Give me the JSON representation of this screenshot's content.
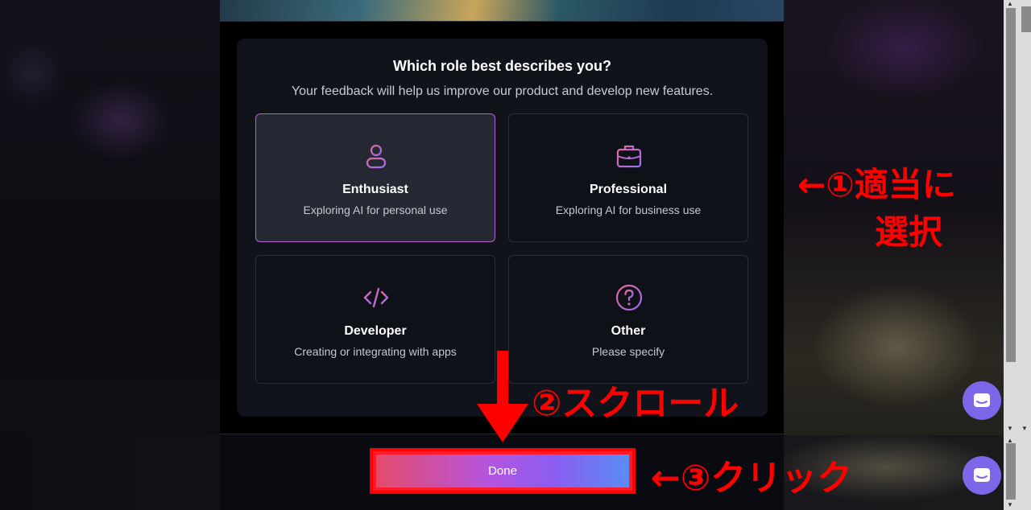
{
  "modal": {
    "title": "Which role best describes you?",
    "subtitle": "Your feedback will help us improve our product and develop new features.",
    "roles": [
      {
        "label": "Enthusiast",
        "desc": "Exploring AI for personal use",
        "icon": "user-icon",
        "selected": true
      },
      {
        "label": "Professional",
        "desc": "Exploring AI for business use",
        "icon": "briefcase-icon",
        "selected": false
      },
      {
        "label": "Developer",
        "desc": "Creating or integrating with apps",
        "icon": "code-icon",
        "selected": false
      },
      {
        "label": "Other",
        "desc": "Please specify",
        "icon": "question-circle-icon",
        "selected": false
      }
    ],
    "done_label": "Done"
  },
  "annotations": {
    "step1_line1": "←①適当に",
    "step1_line2": "選択",
    "step2": "②スクロール",
    "step3": "←③クリック"
  },
  "colors": {
    "accent_gradient": [
      "#e44b6b",
      "#b455e0",
      "#5a8cf5"
    ],
    "annotation_red": "#ff0000",
    "selected_border": "#b45fd6",
    "chat_button": "#7d66e8"
  },
  "chat_buttons": [
    {
      "icon": "chat-icon"
    },
    {
      "icon": "chat-icon"
    }
  ]
}
